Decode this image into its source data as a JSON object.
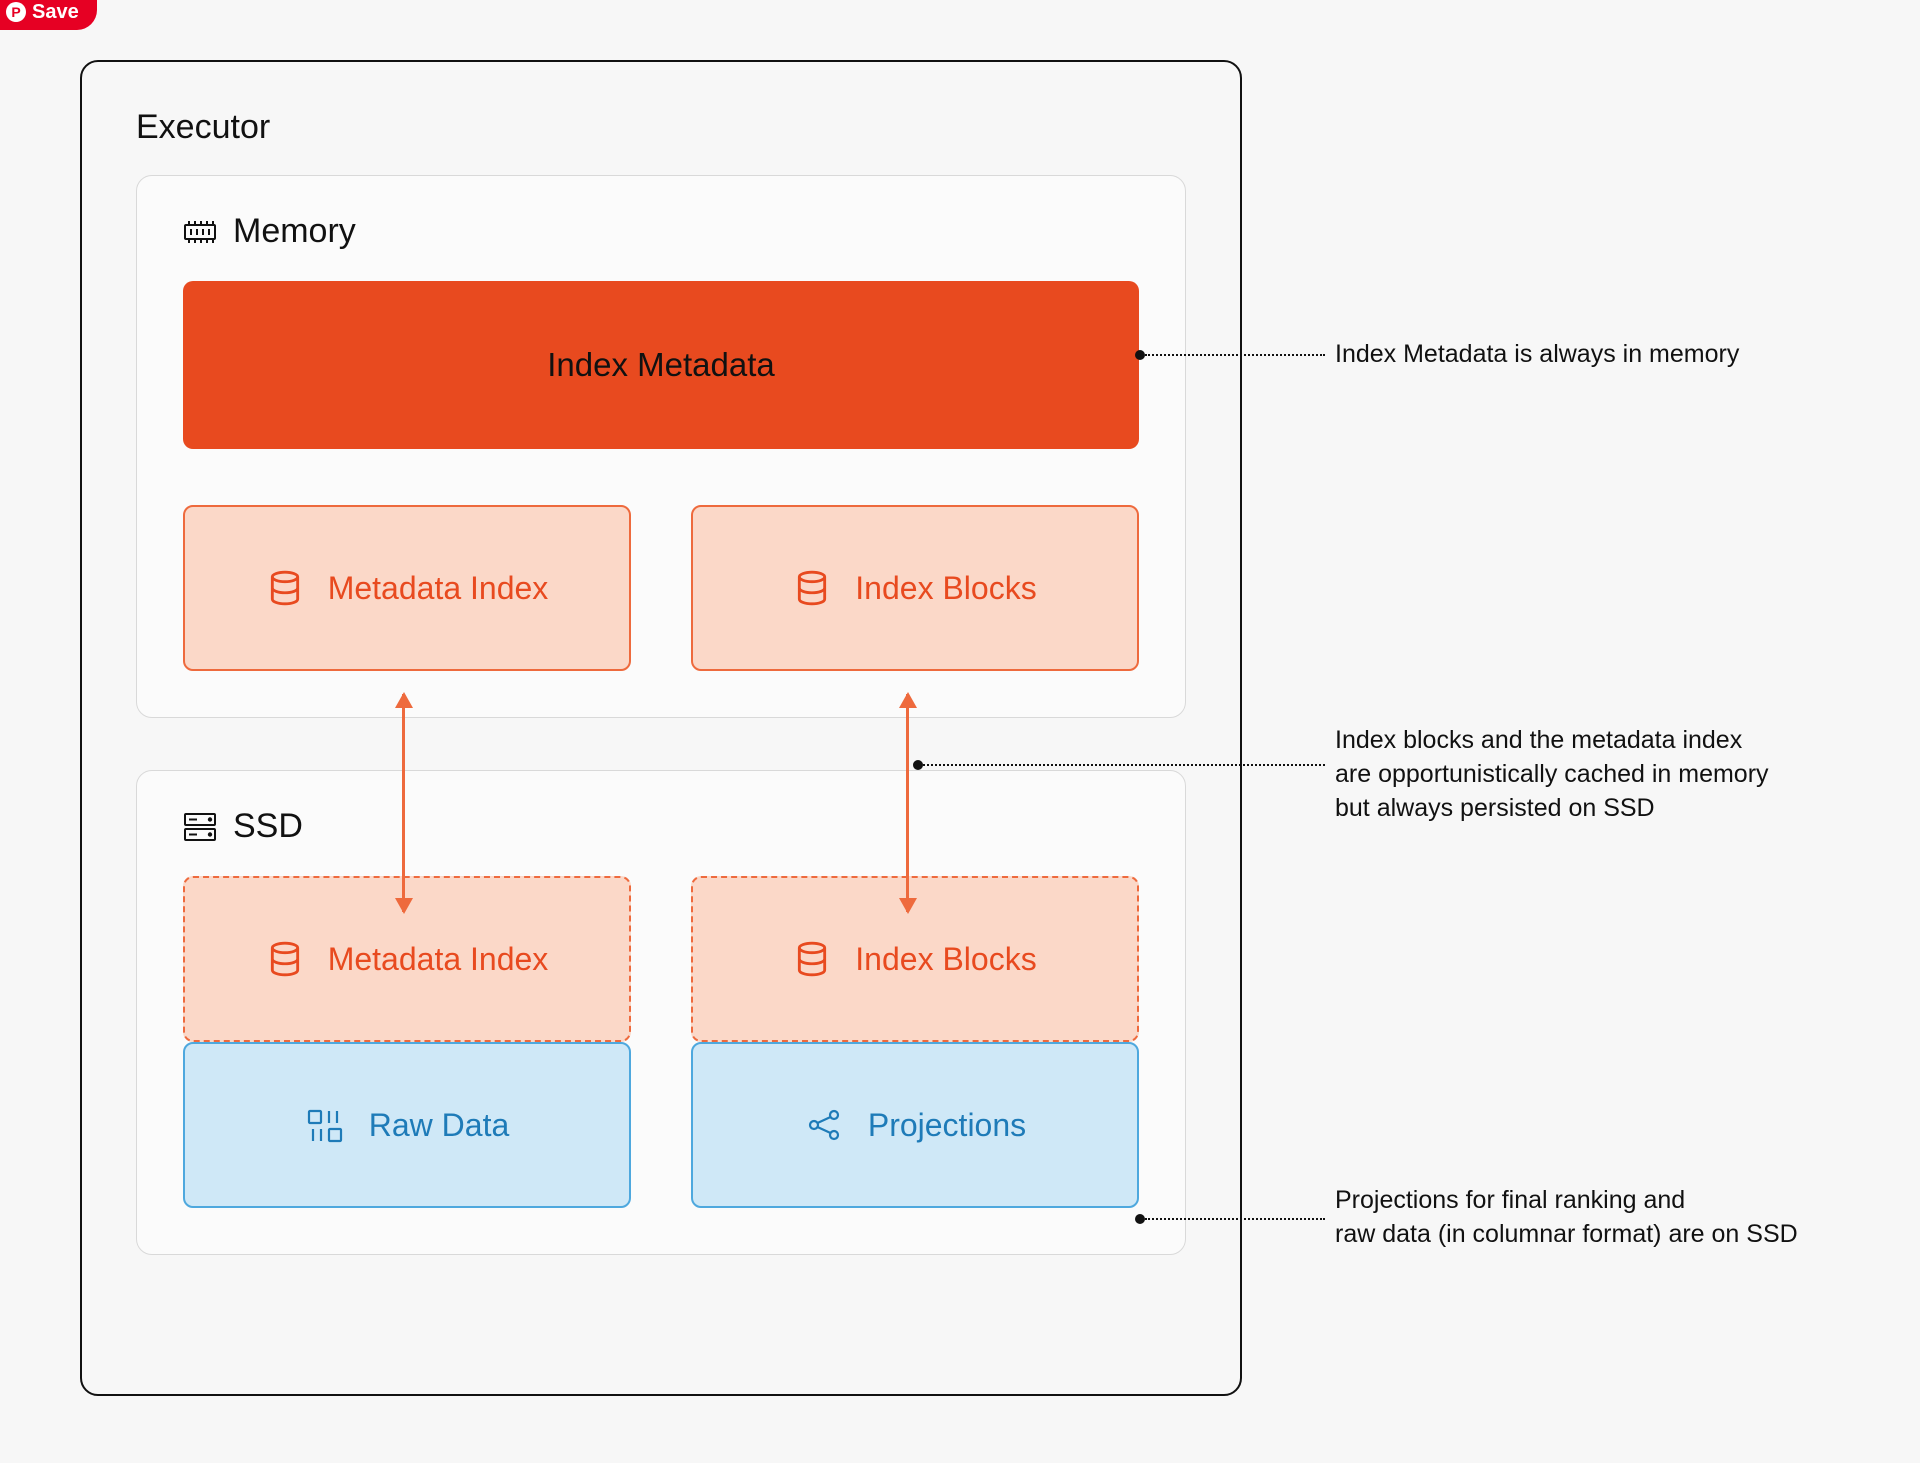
{
  "pinterest": {
    "label": "Save"
  },
  "diagram": {
    "title": "Executor",
    "memory": {
      "title": "Memory",
      "index_metadata": "Index Metadata",
      "metadata_index": "Metadata Index",
      "index_blocks": "Index Blocks"
    },
    "ssd": {
      "title": "SSD",
      "metadata_index": "Metadata Index",
      "index_blocks": "Index Blocks",
      "raw_data": "Raw Data",
      "projections": "Projections"
    },
    "annotations": {
      "a1": "Index Metadata is always in memory",
      "a2_l1": "Index blocks and the metadata index",
      "a2_l2": "are opportunistically cached in memory",
      "a2_l3": "but always persisted on SSD",
      "a3_l1": "Projections for final ranking and",
      "a3_l2": "raw data (in columnar format) are on SSD"
    }
  }
}
